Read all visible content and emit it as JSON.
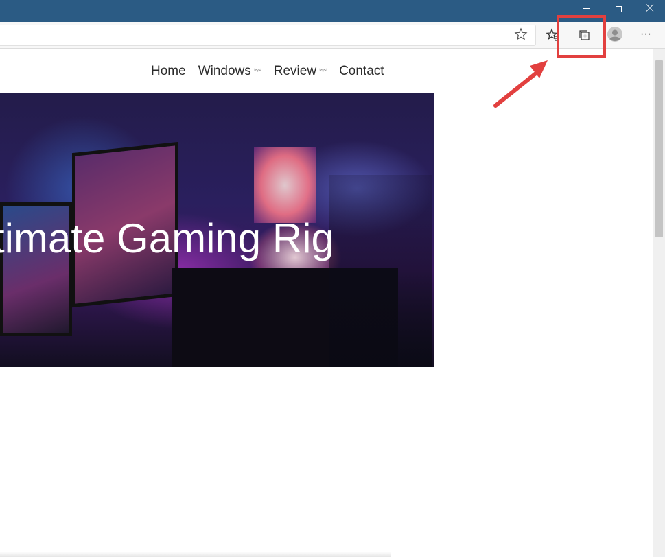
{
  "window": {
    "controls": [
      "minimize-icon",
      "restore-icon",
      "close-icon"
    ]
  },
  "toolbar": {
    "address_value": "",
    "more_label": "···",
    "icons": [
      "star-icon",
      "favorites-icon",
      "collections-icon",
      "profile-icon",
      "more-icon"
    ]
  },
  "site": {
    "nav": [
      {
        "label": "Home",
        "has_dropdown": false
      },
      {
        "label": "Windows",
        "has_dropdown": true
      },
      {
        "label": "Review",
        "has_dropdown": true
      },
      {
        "label": "Contact",
        "has_dropdown": false
      }
    ],
    "dropdown_glyph": "︾",
    "hero_title": "timate Gaming Rig"
  },
  "annotation": {
    "highlight_color": "#e2403f"
  },
  "colors": {
    "titlebar": "#2b5b84",
    "accent": "#e2403f"
  }
}
